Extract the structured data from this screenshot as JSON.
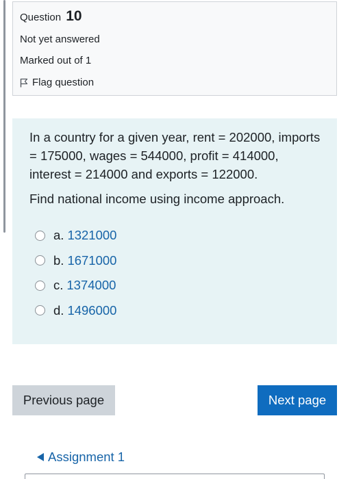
{
  "question_info": {
    "label": "Question",
    "number": "10",
    "state": "Not yet answered",
    "marks": "Marked out of 1",
    "flag_label": "Flag question"
  },
  "question": {
    "text": "In a country for a given year, rent = 202000, imports = 175000, wages = 544000, profit = 414000, interest = 214000 and exports = 122000.",
    "prompt": "Find national income using income approach.",
    "answers": [
      {
        "letter": "a.",
        "value": "1321000"
      },
      {
        "letter": "b.",
        "value": "1671000"
      },
      {
        "letter": "c.",
        "value": "1374000"
      },
      {
        "letter": "d.",
        "value": "1496000"
      }
    ]
  },
  "navigation": {
    "previous_label": "Previous page",
    "next_label": "Next page",
    "back_link_label": "Assignment 1"
  },
  "colors": {
    "info_bg": "#f8f9fa",
    "content_bg": "#e7f3f5",
    "link": "#1764a8",
    "primary_button": "#0f6cbf",
    "secondary_button": "#ced4da"
  }
}
